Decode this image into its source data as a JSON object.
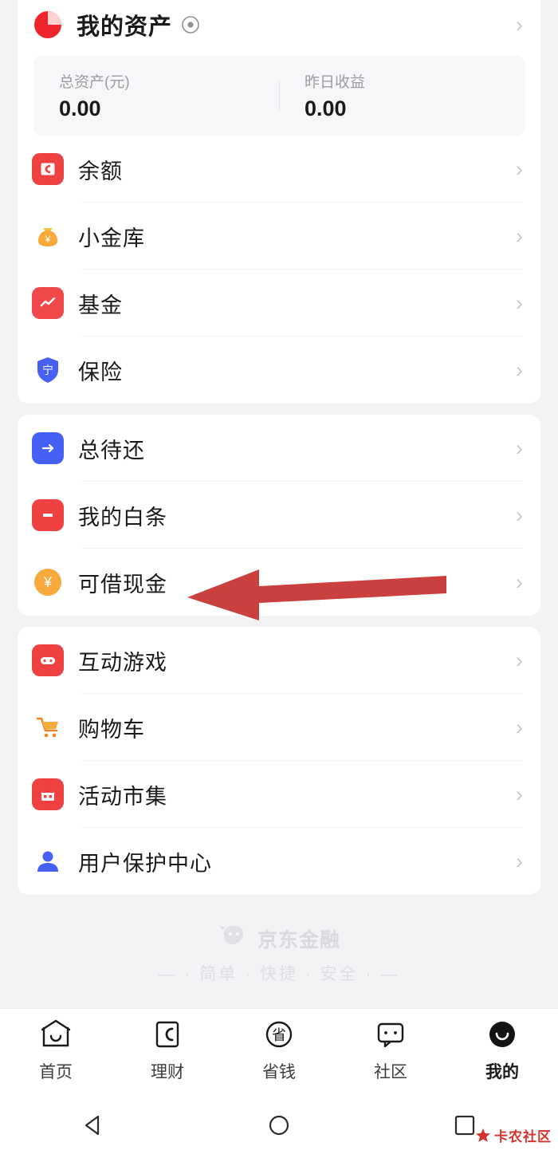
{
  "assets": {
    "title": "我的资产",
    "eye_icon": "eye-icon",
    "chevron": "›",
    "total": {
      "label": "总资产(元)",
      "value": "0.00"
    },
    "yesterday": {
      "label": "昨日收益",
      "value": "0.00"
    }
  },
  "groups": [
    {
      "name": "accounts",
      "rows": [
        {
          "label": "余额",
          "icon": "wallet-icon",
          "color": "#ef4042"
        },
        {
          "label": "小金库",
          "icon": "moneybag-icon",
          "color": "#f7a93b"
        },
        {
          "label": "基金",
          "icon": "chart-icon",
          "color": "#f0474b"
        },
        {
          "label": "保险",
          "icon": "shield-icon",
          "color": "#4560f5"
        }
      ]
    },
    {
      "name": "credit",
      "rows": [
        {
          "label": "总待还",
          "icon": "repay-icon",
          "color": "#4560f5"
        },
        {
          "label": "我的白条",
          "icon": "baitiao-icon",
          "color": "#ef4042"
        },
        {
          "label": "可借现金",
          "icon": "yuan-icon",
          "color": "#f7a93b"
        }
      ]
    },
    {
      "name": "services",
      "rows": [
        {
          "label": "互动游戏",
          "icon": "gamepad-icon",
          "color": "#ef4042"
        },
        {
          "label": "购物车",
          "icon": "cart-icon",
          "color": "#f2851f"
        },
        {
          "label": "活动市集",
          "icon": "calendar-icon",
          "color": "#ef4042"
        },
        {
          "label": "用户保护中心",
          "icon": "person-icon",
          "color": "#4560f5"
        }
      ]
    }
  ],
  "brand": {
    "logo_icon": "jd-dog-icon",
    "name": "京东金融",
    "slogan": "— · 简单 · 快捷 · 安全 · —"
  },
  "tabbar": [
    {
      "label": "首页",
      "icon": "home-icon",
      "active": false
    },
    {
      "label": "理财",
      "icon": "finance-icon",
      "active": false
    },
    {
      "label": "省钱",
      "icon": "save-icon",
      "active": false
    },
    {
      "label": "社区",
      "icon": "community-icon",
      "active": false
    },
    {
      "label": "我的",
      "icon": "profile-icon",
      "active": true
    }
  ],
  "navbar": [
    {
      "name": "back-button",
      "icon": "triangle-back-icon"
    },
    {
      "name": "home-button",
      "icon": "circle-home-icon"
    },
    {
      "name": "recents-button",
      "icon": "square-recents-icon"
    }
  ],
  "annotation": {
    "arrow": "red-arrow-pointing-left",
    "arrow_color": "#c9403f"
  },
  "watermark": {
    "text": "卡农社区",
    "color": "#d6332f"
  }
}
